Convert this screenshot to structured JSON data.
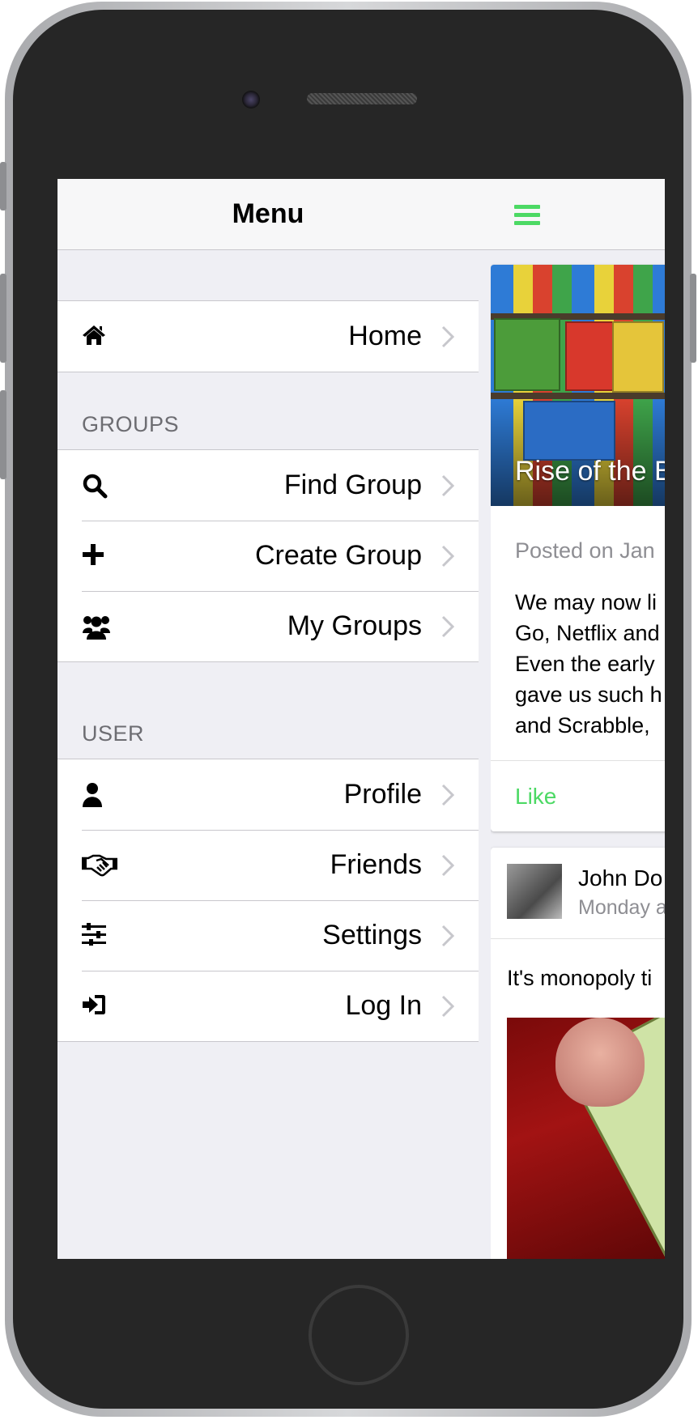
{
  "menu": {
    "title": "Menu",
    "home": {
      "label": "Home",
      "icon": "home-icon"
    },
    "groups": {
      "section_label": "GROUPS",
      "items": [
        {
          "label": "Find Group",
          "icon": "search-icon"
        },
        {
          "label": "Create Group",
          "icon": "plus-icon"
        },
        {
          "label": "My Groups",
          "icon": "users-icon"
        }
      ]
    },
    "user": {
      "section_label": "USER",
      "items": [
        {
          "label": "Profile",
          "icon": "user-icon"
        },
        {
          "label": "Friends",
          "icon": "handshake-icon"
        },
        {
          "label": "Settings",
          "icon": "sliders-icon"
        },
        {
          "label": "Log In",
          "icon": "sign-in-icon"
        }
      ]
    }
  },
  "header": {
    "menu_toggle_icon": "hamburger-icon"
  },
  "feed": {
    "article_card": {
      "overlay_title": "Rise of the B",
      "posted_on": "Posted on Jan",
      "text_lines": [
        "We may now li",
        "Go, Netflix and",
        "Even the early",
        "gave us such h",
        "and Scrabble,"
      ],
      "like_label": "Like"
    },
    "post_card": {
      "author": "John Do",
      "date": "Monday a",
      "text": "It's monopoly ti"
    }
  },
  "colors": {
    "accent": "#4cd964",
    "background": "#efeff4",
    "nav_bar": "#f7f7f8",
    "separator": "#c8c7cc",
    "section_text": "#6d6d72",
    "phone_body": "#262626"
  }
}
